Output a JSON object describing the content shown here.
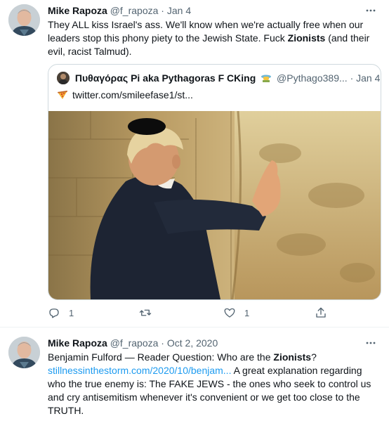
{
  "tweets": [
    {
      "author": {
        "name": "Mike Rapoza",
        "handle": "@f_rapoza",
        "dot": "·",
        "date": "Jan 4"
      },
      "text_parts": {
        "p1": "They ALL kiss Israel's ass. We'll know when we're actually free when our leaders stop this phony piety to the Jewish State. Fuck ",
        "bold": "Zionists",
        "p2": " (and their evil, racist Talmud)."
      },
      "quote": {
        "name": "Πυθαγόρας Pi aka Pythagoras F CKing",
        "handle": "@Pythago389...",
        "dot": "·",
        "date": "Jan 4",
        "link": "twitter.com/smileefase1/st..."
      },
      "actions": {
        "reply_count": "1",
        "retweet_count": "",
        "like_count": "1"
      }
    },
    {
      "author": {
        "name": "Mike Rapoza",
        "handle": "@f_rapoza",
        "dot": "·",
        "date": "Oct 2, 2020"
      },
      "text_parts": {
        "p1": "Benjamin Fulford — Reader Question: Who are the ",
        "bold": "Zionists",
        "p2": "?",
        "link": "stillnessinthestorm.com/2020/10/benjam...",
        "p3": " A great explanation regarding who the true enemy is: The FAKE JEWS - the ones who seek to control us and cry antisemitism whenever it's convenient or we get too close to the TRUTH."
      }
    }
  ],
  "icons": {
    "more": "more-horizontal-icon",
    "reply": "reply-icon",
    "retweet": "retweet-icon",
    "like": "heart-icon",
    "share": "share-icon",
    "pizza": "pizza-emoji-icon",
    "badge": "emoji-badge-icon"
  },
  "colors": {
    "link": "#1d9bf0",
    "secondary": "#536471",
    "border": "#cfd9de",
    "text": "#0f1419"
  }
}
